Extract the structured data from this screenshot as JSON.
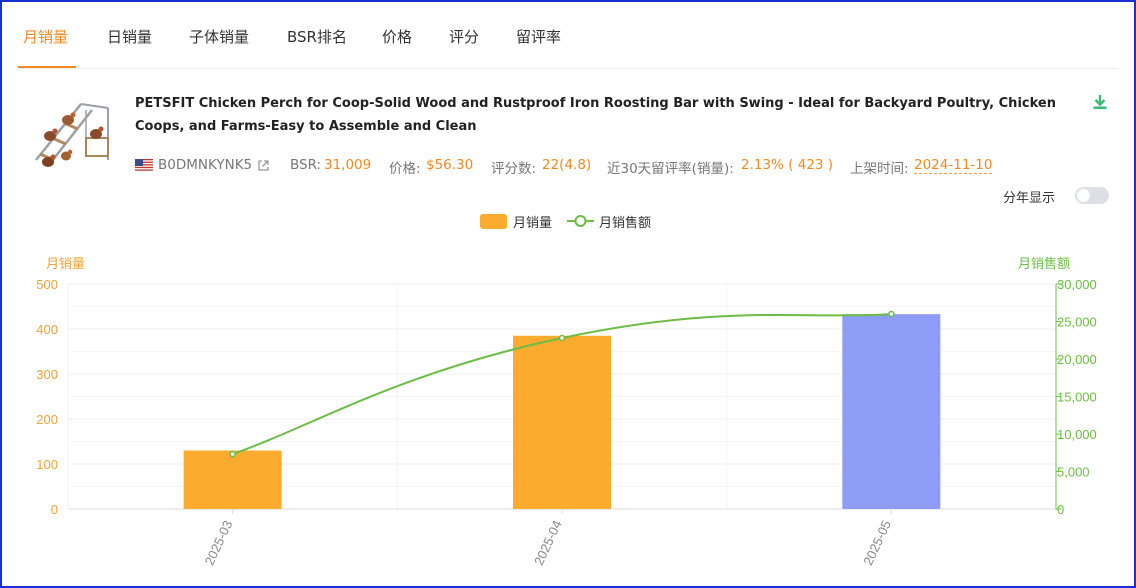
{
  "tabs": [
    {
      "label": "月销量",
      "active": true
    },
    {
      "label": "日销量",
      "active": false
    },
    {
      "label": "子体销量",
      "active": false
    },
    {
      "label": "BSR排名",
      "active": false
    },
    {
      "label": "价格",
      "active": false
    },
    {
      "label": "评分",
      "active": false
    },
    {
      "label": "留评率",
      "active": false
    }
  ],
  "product": {
    "title": "PETSFIT Chicken Perch for Coop-Solid Wood and Rustproof Iron Roosting Bar with Swing - Ideal for Backyard Poultry, Chicken Coops, and Farms-Easy to Assemble and Clean",
    "asin": "B0DMNKYNK5",
    "bsr_label": "BSR:",
    "bsr_value": "31,009",
    "price_label": "价格:",
    "price_value": "$56.30",
    "rating_label": "评分数:",
    "rating_value": "22(4.8)",
    "review_rate_label": "近30天留评率(销量):",
    "review_rate_value": "2.13% ( 423 )",
    "listed_label": "上架时间:",
    "listed_value": "2024-11-10"
  },
  "toggle": {
    "label": "分年显示",
    "on": false
  },
  "icons": {
    "flag": "us-flag-icon",
    "external": "external-link-icon",
    "download": "download-icon"
  },
  "colors": {
    "accent": "#f08a24",
    "bar": "#fbab2e",
    "bar_highlight": "#8e9cf5",
    "line": "#6cbd45",
    "download": "#3cb878"
  },
  "chart_data": {
    "type": "bar",
    "categories": [
      "2025-03",
      "2025-04",
      "2025-05"
    ],
    "series": [
      {
        "name": "月销量",
        "type": "bar",
        "axis": "left",
        "values": [
          130,
          385,
          433
        ]
      },
      {
        "name": "月销售额",
        "type": "line",
        "axis": "right",
        "values": [
          7320,
          22800,
          26000
        ]
      }
    ],
    "ylabel": "月销量",
    "ylabel_right": "月销售额",
    "ylim": [
      0,
      500
    ],
    "ylim_right": [
      0,
      30000
    ],
    "yticks": [
      "0",
      "100",
      "200",
      "300",
      "400",
      "500"
    ],
    "yticks_right": [
      "0",
      "5,000",
      "10,000",
      "15,000",
      "20,000",
      "25,000",
      "30,000"
    ],
    "legend_position": "top-center",
    "grid": true
  }
}
